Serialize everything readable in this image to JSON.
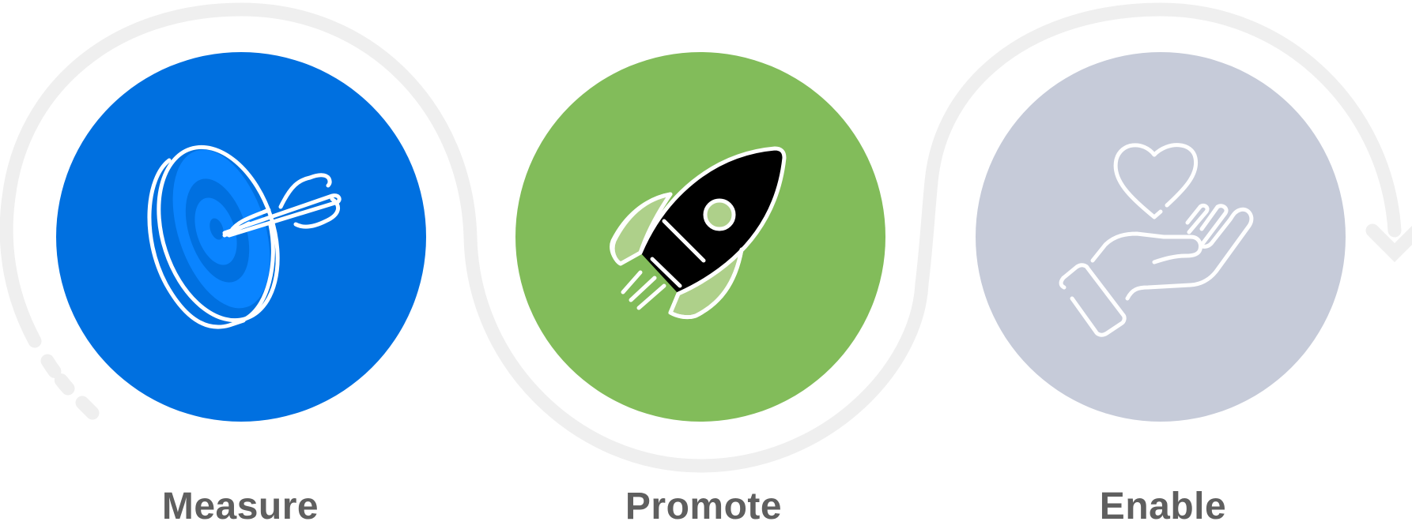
{
  "steps": [
    {
      "label": "Measure",
      "icon": "target-dart-icon",
      "color": "#0070e0"
    },
    {
      "label": "Promote",
      "icon": "rocket-icon",
      "color": "#82bc5a"
    },
    {
      "label": "Enable",
      "icon": "hand-heart-icon",
      "color": "#c6cbd9"
    }
  ],
  "colors": {
    "connector": "#efefef",
    "label_text": "#5f5f5f",
    "icon_stroke": "#ffffff",
    "target_fill": "#0a84ff",
    "rocket_fill": "#aed08a"
  }
}
